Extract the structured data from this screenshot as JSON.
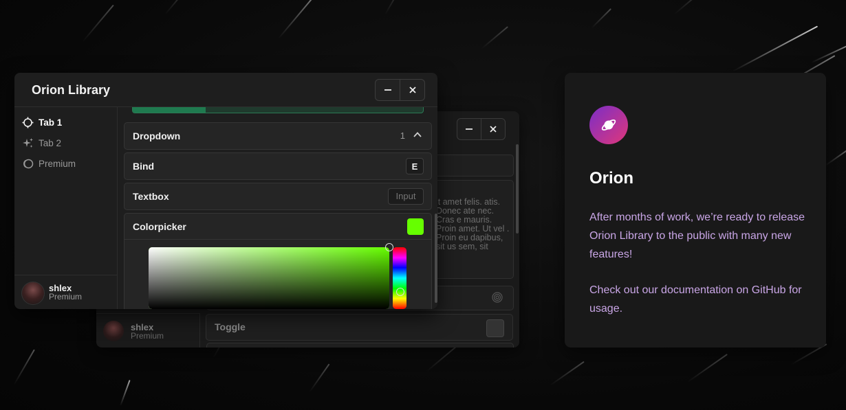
{
  "colors": {
    "accent_purple": "#c9a6e6",
    "slider_green": "#1f7a4f",
    "picked_color": "#66ff00",
    "logo_gradient_start": "#7a2ec7",
    "logo_gradient_end": "#e0377a"
  },
  "front_window": {
    "title": "Orion Library",
    "minimize_icon": "minus-icon",
    "close_icon": "x-icon",
    "tabs": [
      {
        "label": "Tab 1",
        "icon": "crosshair-icon",
        "active": true
      },
      {
        "label": "Tab 2",
        "icon": "sparkles-icon",
        "active": false
      },
      {
        "label": "Premium",
        "icon": "premium-ring-icon",
        "active": false
      }
    ],
    "user": {
      "name": "shlex",
      "subtitle": "Premium"
    },
    "slider": {
      "fill_fraction": 0.25
    },
    "dropdown": {
      "label": "Dropdown",
      "count": "1"
    },
    "bind": {
      "label": "Bind",
      "key": "E"
    },
    "textbox": {
      "label": "Textbox",
      "placeholder": "Input"
    },
    "colorpicker": {
      "label": "Colorpicker",
      "value": "#66ff00",
      "hue": "#66ff00",
      "saturation": 1.0,
      "brightness": 1.0,
      "hue_fraction": 0.72
    }
  },
  "back_window": {
    "paragraph": "it amet felis. atis. Donec ate nec. Cras e mauris. Proin amet. Ut vel . Proin eu dapibus, sit us sem, sit",
    "toggle_label": "Toggle",
    "user": {
      "name": "shlex",
      "subtitle": "Premium"
    }
  },
  "card": {
    "title": "Orion",
    "paragraph_1": "After months of work, we’re ready to release Orion Library to the public with many new features!",
    "paragraph_2": "Check out our documentation on GitHub for usage."
  }
}
